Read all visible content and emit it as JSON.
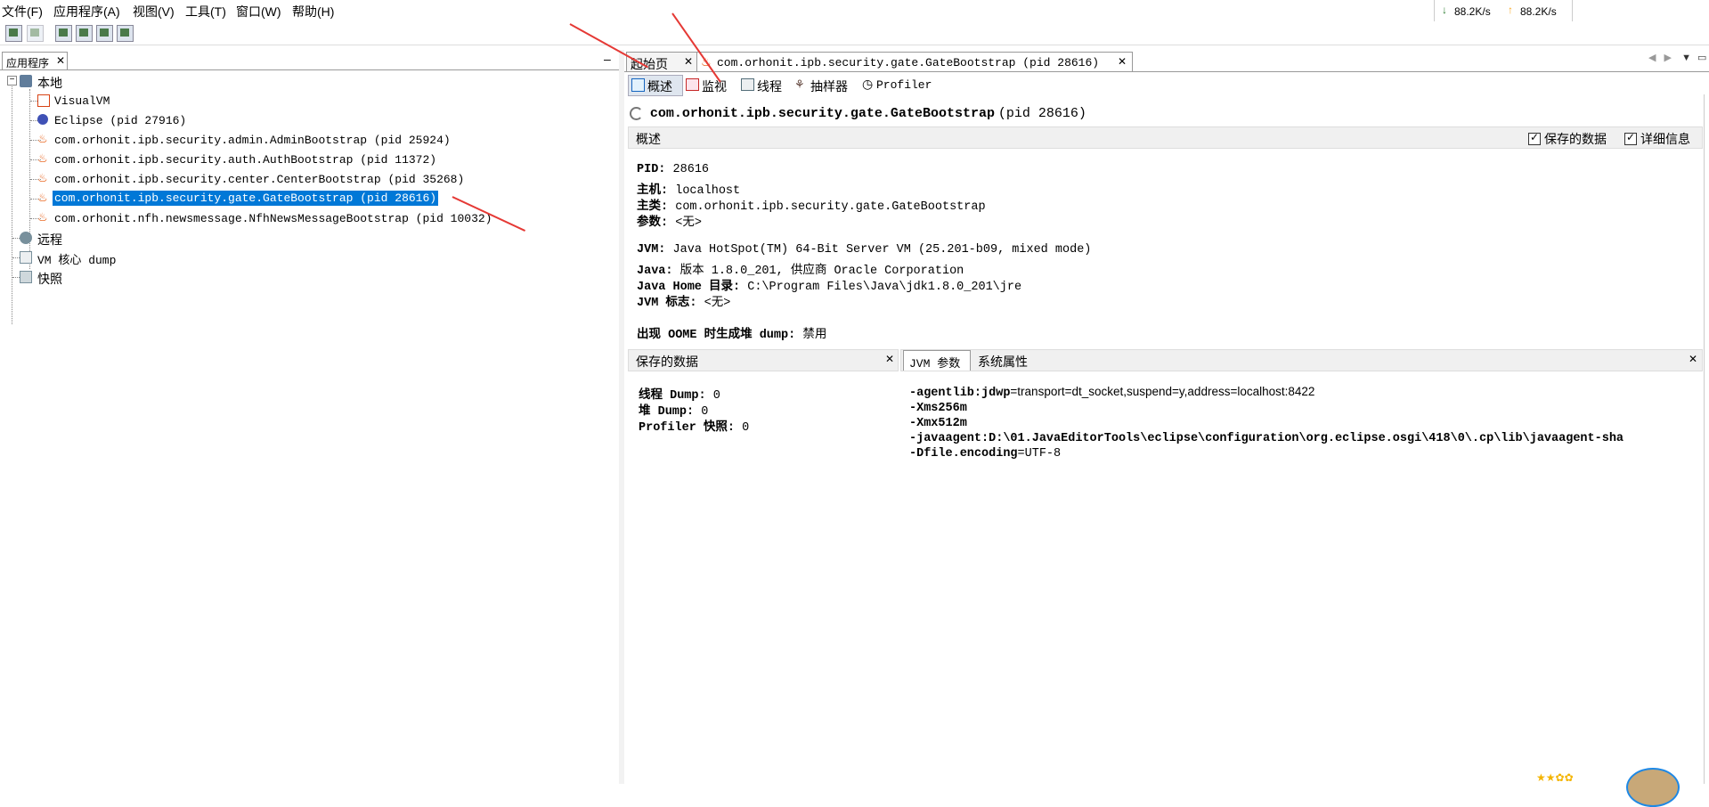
{
  "menubar": {
    "items": [
      "文件(F)",
      "应用程序(A)",
      "视图(V)",
      "工具(T)",
      "窗口(W)",
      "帮助(H)"
    ]
  },
  "netspeed": {
    "down": "88.2K/s",
    "up": "88.2K/s"
  },
  "left_panel": {
    "tab_label": "应用程序",
    "tree": {
      "local": "本地",
      "children": [
        "VisualVM",
        "Eclipse (pid 27916)",
        "com.orhonit.ipb.security.admin.AdminBootstrap (pid 25924)",
        "com.orhonit.ipb.security.auth.AuthBootstrap (pid 11372)",
        "com.orhonit.ipb.security.center.CenterBootstrap (pid 35268)",
        "com.orhonit.ipb.security.gate.GateBootstrap (pid 28616)",
        "com.orhonit.nfh.newsmessage.NfhNewsMessageBootstrap (pid 10032)"
      ],
      "remote": "远程",
      "coredump": "VM 核心 dump",
      "snapshots": "快照"
    }
  },
  "right_panel": {
    "tabs": [
      "起始页",
      "com.orhonit.ipb.security.gate.GateBootstrap (pid 28616)"
    ],
    "subtabs": [
      "概述",
      "监视",
      "线程",
      "抽样器",
      "Profiler"
    ],
    "app_title": "com.orhonit.ipb.security.gate.GateBootstrap",
    "app_pid": "(pid 28616)",
    "overview_header": "概述",
    "checkbox_saved": "保存的数据",
    "checkbox_details": "详细信息",
    "info": {
      "pid_label": "PID:",
      "pid": "28616",
      "host_label": "主机:",
      "host": "localhost",
      "mainclass_label": "主类:",
      "mainclass": "com.orhonit.ipb.security.gate.GateBootstrap",
      "args_label": "参数:",
      "args": "<无>",
      "jvm_label": "JVM:",
      "jvm": "Java HotSpot(TM) 64-Bit Server VM (25.201-b09, mixed mode)",
      "java_label": "Java:",
      "java": "版本 1.8.0_201, 供应商 Oracle Corporation",
      "javahome_label": "Java Home 目录:",
      "javahome": "C:\\Program Files\\Java\\jdk1.8.0_201\\jre",
      "jvmflags_label": "JVM 标志:",
      "jvmflags": "<无>",
      "oome_label": "出现 OOME 时生成堆 dump:",
      "oome": "禁用"
    },
    "saved_data": {
      "header": "保存的数据",
      "thread_dump_label": "线程 Dump:",
      "thread_dump": "0",
      "heap_dump_label": "堆 Dump:",
      "heap_dump": "0",
      "profiler_label": "Profiler 快照:",
      "profiler": "0"
    },
    "jvm_args": {
      "tabs": [
        "JVM 参数",
        "系统属性"
      ],
      "lines": [
        {
          "flag": "-agentlib:jdwp",
          "value": "=transport=dt_socket,suspend=y,address=localhost:8422"
        },
        {
          "flag": "-Xms256m",
          "value": ""
        },
        {
          "flag": "-Xmx512m",
          "value": ""
        },
        {
          "flag": "-javaagent:D:\\01.JavaEditorTools\\eclipse\\configuration\\org.eclipse.osgi\\418\\0\\.cp\\lib\\javaagent-sha",
          "value": ""
        },
        {
          "flag": "-Dfile.encoding",
          "value": "=UTF-8"
        }
      ]
    }
  },
  "colors": {
    "selection": "#0078d7",
    "annotation_arrow": "#e53935"
  }
}
